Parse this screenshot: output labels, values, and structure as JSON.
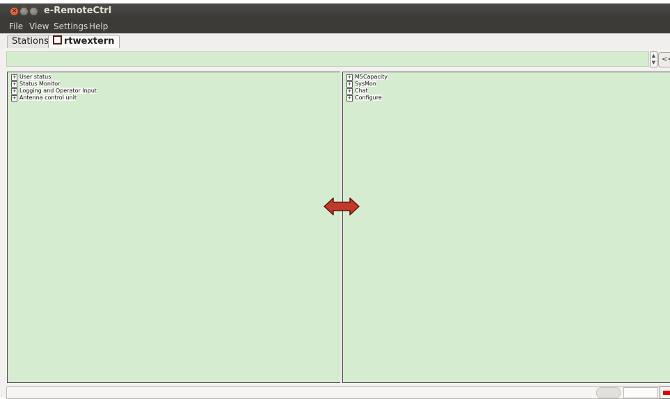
{
  "window": {
    "title": "e-RemoteCtrl"
  },
  "menu": [
    "File",
    "View",
    "Settings",
    "Help"
  ],
  "tabs": [
    {
      "label": "Stations",
      "active": false
    },
    {
      "label": "rtwextern",
      "active": true
    }
  ],
  "command_bar": {
    "value": "",
    "collapse_label": "<<"
  },
  "left_panel": {
    "items": [
      "User status",
      "Status Monitor",
      "Logging and Operator Input",
      "Antenna control unit"
    ]
  },
  "right_panel": {
    "items": [
      "M5Capacity",
      "SysMon",
      "Chat",
      "Configure"
    ]
  },
  "icons": {
    "tree_expand": "plus-box-icon",
    "splitter": "double-arrow-icon",
    "status_indicator": "red-led-icon"
  },
  "colors": {
    "panel_bg": "#d6ecd0",
    "titlebar": "#3c3b37",
    "close_button": "#df4a16",
    "splitter_arrow": "#c0392b",
    "status_led": "#e00000"
  }
}
